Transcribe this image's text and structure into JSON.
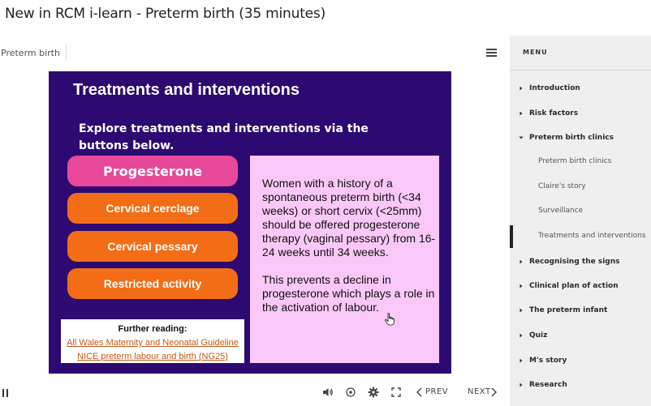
{
  "page_title": "New in RCM i-learn - Preterm birth (35 minutes)",
  "course_name": "Preterm birth",
  "slide": {
    "title": "Treatments and interventions",
    "instructions": "Explore treatments and interventions via the buttons below.",
    "buttons": [
      {
        "label": "Progesterone"
      },
      {
        "label": "Cervical cerclage"
      },
      {
        "label": "Cervical pessary"
      },
      {
        "label": "Restricted activity"
      }
    ],
    "info_text": "Women with a history of a spontaneous preterm birth (<34 weeks) or short cervix (<25mm) should be offered progesterone therapy (vaginal pessary) from 16-24 weeks until 34 weeks.\n\nThis prevents a decline in progesterone which plays a role in the activation of labour.",
    "further_reading": {
      "heading": "Further reading:",
      "links": [
        "All Wales Maternity and Neonatal Guideline",
        "NICE preterm labour and birth (NG25)"
      ]
    }
  },
  "controls": {
    "prev_label": "PREV",
    "next_label": "NEXT"
  },
  "menu": {
    "title": "MENU",
    "items": [
      {
        "label": "Introduction"
      },
      {
        "label": "Risk factors"
      },
      {
        "label": "Preterm birth clinics"
      },
      {
        "label": "Recognising the signs"
      },
      {
        "label": "Clinical plan of action"
      },
      {
        "label": "The preterm infant"
      },
      {
        "label": "Quiz"
      },
      {
        "label": "M's story"
      },
      {
        "label": "Research"
      }
    ],
    "sub_items": [
      {
        "label": "Preterm birth clinics"
      },
      {
        "label": "Claire's story"
      },
      {
        "label": "Surveillance"
      },
      {
        "label": "Treatments and interventions"
      }
    ]
  },
  "colors": {
    "slide_bg": "#2c0a72",
    "active_button": "#e8489a",
    "button": "#f36d16",
    "info_panel": "#f9c8f8",
    "link": "#c35a1a"
  }
}
